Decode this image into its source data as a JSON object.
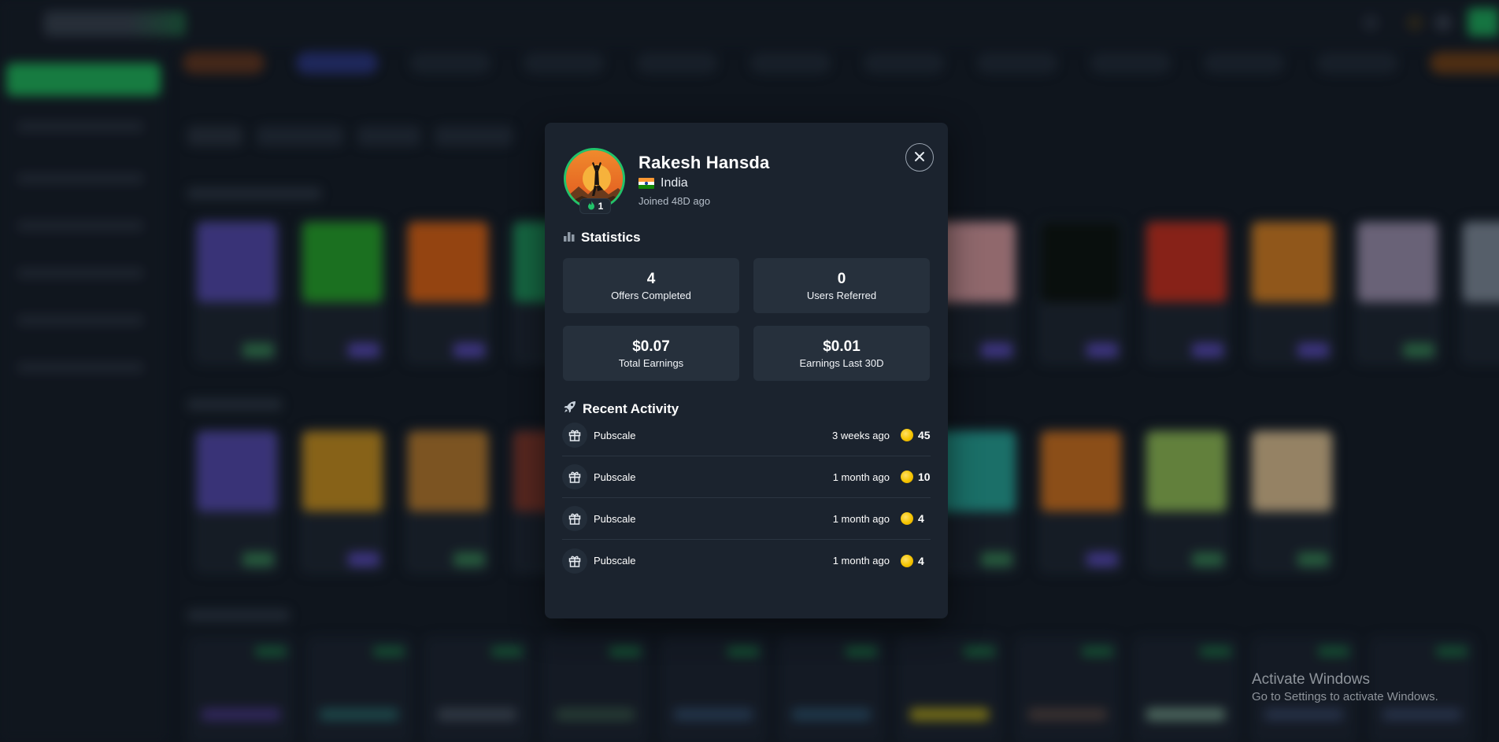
{
  "colors": {
    "background": "#141b24",
    "modal_background": "#1b232e",
    "stat_card_background": "#26303c",
    "accent_green": "#22c36a",
    "coin_gold": "#f5c400"
  },
  "profile": {
    "name": "Rakesh Hansda",
    "country": "India",
    "flag_icon": "india-flag-icon",
    "joined": "Joined 48D ago",
    "level": "1",
    "level_icon": "flame-icon",
    "avatar_icon": "yoga-sunset-avatar-icon"
  },
  "modal": {
    "close_icon": "close-icon"
  },
  "statistics": {
    "title": "Statistics",
    "icon": "bar-chart-icon",
    "items": [
      {
        "value": "4",
        "label": "Offers Completed"
      },
      {
        "value": "0",
        "label": "Users Referred"
      },
      {
        "value": "$0.07",
        "label": "Total Earnings"
      },
      {
        "value": "$0.01",
        "label": "Earnings Last 30D"
      }
    ]
  },
  "recent_activity": {
    "title": "Recent Activity",
    "icon": "rocket-icon",
    "items": [
      {
        "icon": "gift-icon",
        "source": "Pubscale",
        "time": "3 weeks ago",
        "amount": "45"
      },
      {
        "icon": "gift-icon",
        "source": "Pubscale",
        "time": "1 month ago",
        "amount": "10"
      },
      {
        "icon": "gift-icon",
        "source": "Pubscale",
        "time": "1 month ago",
        "amount": "4"
      },
      {
        "icon": "gift-icon",
        "source": "Pubscale",
        "time": "1 month ago",
        "amount": "4"
      }
    ]
  },
  "os_watermark": {
    "title": "Activate Windows",
    "subtitle": "Go to Settings to activate Windows."
  }
}
